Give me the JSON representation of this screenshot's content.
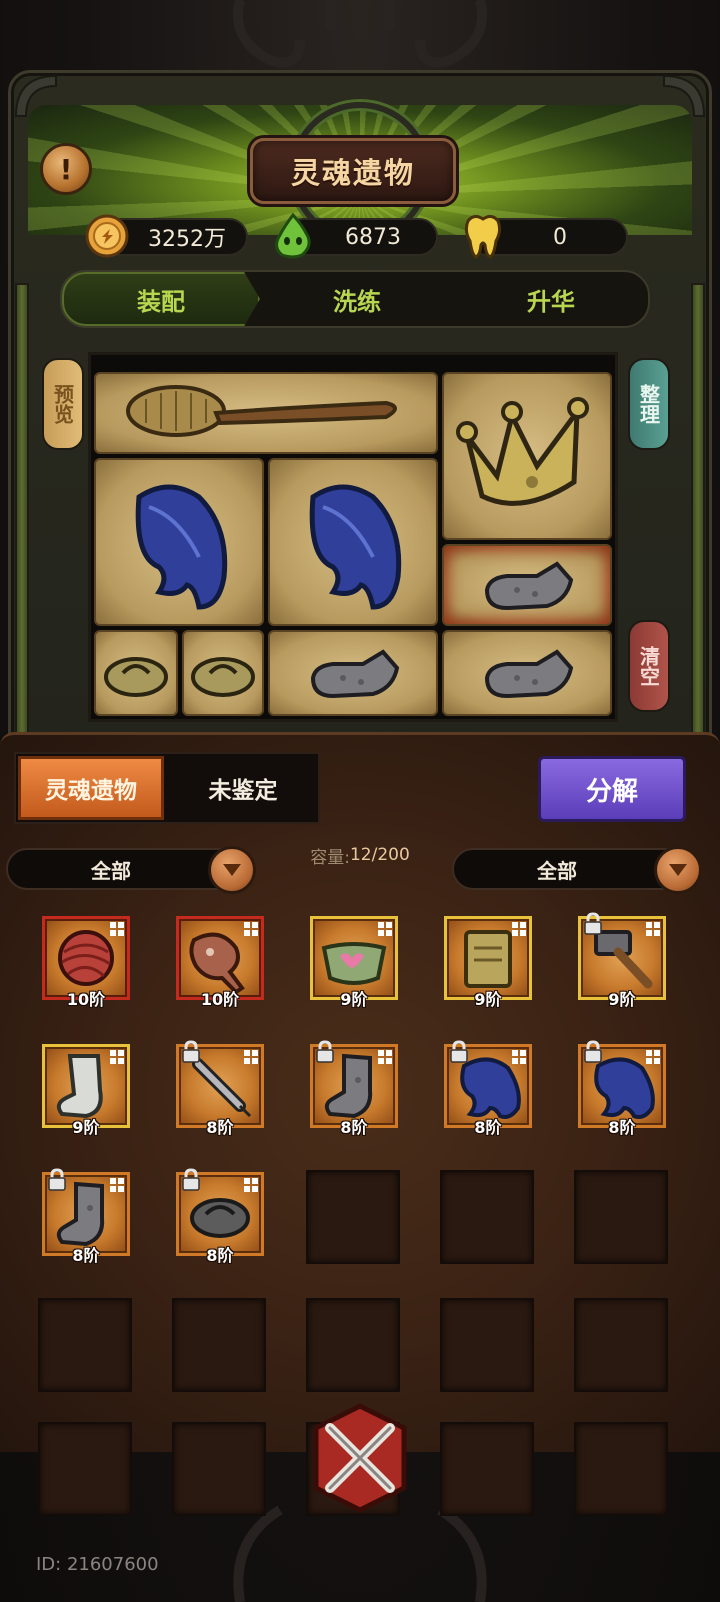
{
  "header": {
    "title": "灵魂遗物",
    "info_icon": "exclamation-icon"
  },
  "currencies": [
    {
      "icon": "gold-coin-icon",
      "value": "3252万"
    },
    {
      "icon": "green-soul-icon",
      "value": "6873"
    },
    {
      "icon": "tooth-icon",
      "value": "0"
    }
  ],
  "tabs": [
    {
      "label": "装配",
      "active": true
    },
    {
      "label": "洗练",
      "active": false
    },
    {
      "label": "升华",
      "active": false
    }
  ],
  "side_buttons": {
    "preview": "预览",
    "sort": "整理",
    "clear": "清空"
  },
  "equipped": [
    {
      "name": "back-scrubber-brush-icon"
    },
    {
      "name": "crown-icon"
    },
    {
      "name": "blue-feather-icon"
    },
    {
      "name": "blue-feather-icon"
    },
    {
      "name": "gray-sock-icon"
    },
    {
      "name": "wooden-sandal-icon"
    },
    {
      "name": "wooden-sandal-icon"
    },
    {
      "name": "gray-sock-icon"
    },
    {
      "name": "gray-sock-icon"
    }
  ],
  "inventory": {
    "tab_active": "灵魂遗物",
    "tab_other": "未鉴定",
    "decompose": "分解",
    "filter_left": "全部",
    "filter_right": "全部",
    "capacity_label": "容量:",
    "capacity_value": "12/200",
    "items": [
      {
        "icon": "yarn-ball-icon",
        "tier": "10阶",
        "rarity": "red",
        "locked": false
      },
      {
        "icon": "ham-leg-icon",
        "tier": "10阶",
        "rarity": "red",
        "locked": false
      },
      {
        "icon": "cloth-pouch-icon",
        "tier": "9阶",
        "rarity": "gold",
        "locked": false
      },
      {
        "icon": "notebook-icon",
        "tier": "9阶",
        "rarity": "gold",
        "locked": false
      },
      {
        "icon": "hammer-icon",
        "tier": "9阶",
        "rarity": "gold",
        "locked": true
      },
      {
        "icon": "white-sock-icon",
        "tier": "9阶",
        "rarity": "gold",
        "locked": false
      },
      {
        "icon": "syringe-icon",
        "tier": "8阶",
        "rarity": "orange",
        "locked": true
      },
      {
        "icon": "gray-sock-icon",
        "tier": "8阶",
        "rarity": "orange",
        "locked": true
      },
      {
        "icon": "blue-feather-icon",
        "tier": "8阶",
        "rarity": "orange",
        "locked": true
      },
      {
        "icon": "blue-feather-icon",
        "tier": "8阶",
        "rarity": "orange",
        "locked": true
      },
      {
        "icon": "gray-sock-icon",
        "tier": "8阶",
        "rarity": "orange",
        "locked": true
      },
      {
        "icon": "wooden-sandal-icon",
        "tier": "8阶",
        "rarity": "orange",
        "locked": true
      }
    ]
  },
  "footer": {
    "close_icon": "crossed-swords-close-icon",
    "player_id": "ID: 21607600"
  },
  "colors": {
    "accent_green": "#b8d64f",
    "decompose_purple": "#5a3db8",
    "tab_orange": "#c25a1c"
  }
}
